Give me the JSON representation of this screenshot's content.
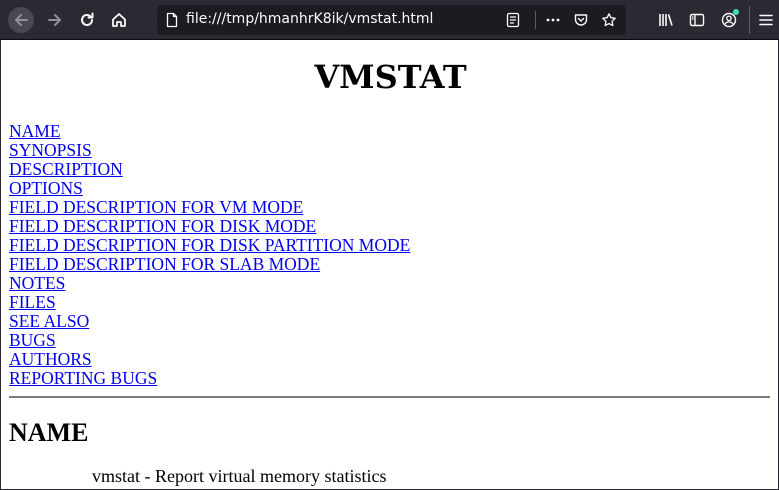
{
  "browser": {
    "url": "file:///tmp/hmanhrK8ik/vmstat.html",
    "icons": {
      "back": "back-arrow-icon",
      "forward": "forward-arrow-icon",
      "reload": "reload-icon",
      "home": "home-icon",
      "page": "page-icon",
      "reader": "reader-view-icon",
      "more": "more-icon",
      "pocket": "pocket-icon",
      "bookmark": "star-icon",
      "library": "library-icon",
      "sidebar": "sidebar-icon",
      "account": "account-icon",
      "menu": "hamburger-menu-icon"
    },
    "colors": {
      "toolbar_bg": "#2b2a33",
      "urlbar_bg": "#1c1b22",
      "text": "#fbfbfe"
    }
  },
  "page": {
    "title": "VMSTAT",
    "toc": [
      "NAME",
      "SYNOPSIS",
      "DESCRIPTION",
      "OPTIONS",
      "FIELD DESCRIPTION FOR VM MODE",
      "FIELD DESCRIPTION FOR DISK MODE",
      "FIELD DESCRIPTION FOR DISK PARTITION MODE",
      "FIELD DESCRIPTION FOR SLAB MODE",
      "NOTES",
      "FILES",
      "SEE ALSO",
      "BUGS",
      "AUTHORS",
      "REPORTING BUGS"
    ],
    "section_heading": "NAME",
    "section_text": "vmstat - Report virtual memory statistics",
    "link_color": "#0000ee"
  }
}
